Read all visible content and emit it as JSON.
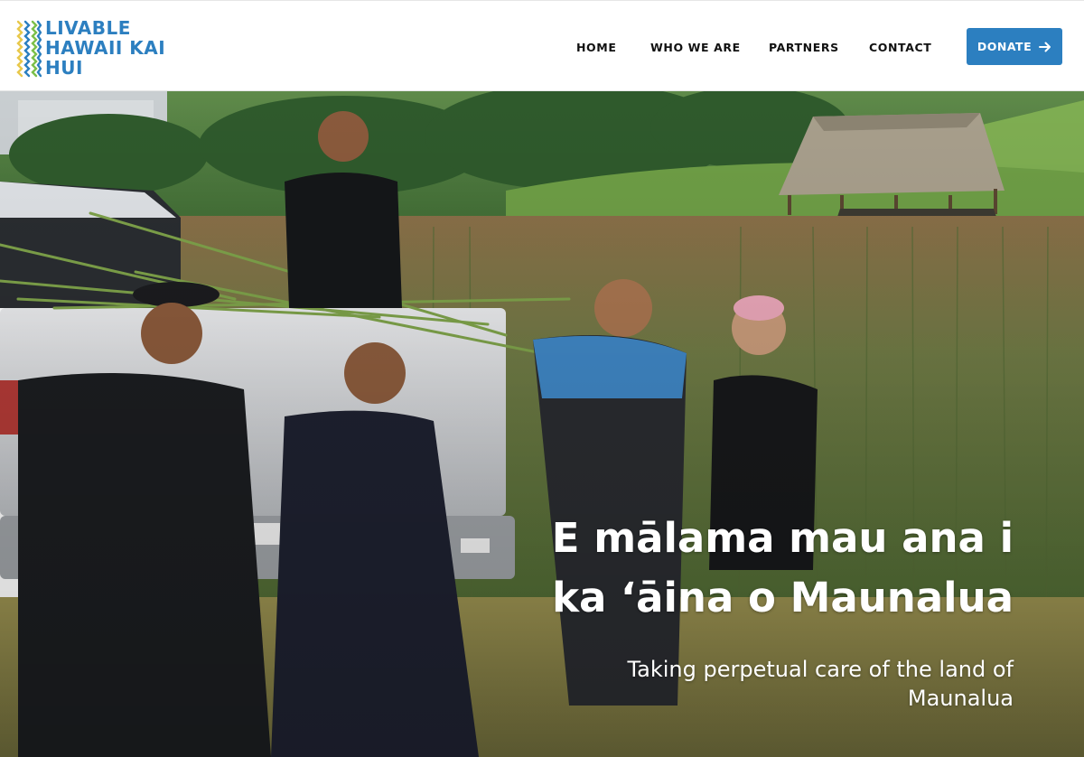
{
  "logo": {
    "lines": [
      "LIVABLE",
      "HAWAII KAI",
      "HUI"
    ],
    "icon": "kapa-pattern-icon"
  },
  "nav": {
    "items": [
      {
        "label": "HOME"
      },
      {
        "label": "WHO WE ARE"
      },
      {
        "label": "PARTNERS"
      },
      {
        "label": "CONTACT"
      }
    ]
  },
  "donate": {
    "label": "DONATE",
    "icon": "arrow-right-icon"
  },
  "hero": {
    "title": "E mālama mau ana i ka ʻāina o Maunalua",
    "subtitle": "Taking perpetual care of the land of Maunalua",
    "photo_icon": "volunteers-photo"
  },
  "colors": {
    "brand_blue": "#2c7fc0",
    "header_bg": "#ffffff",
    "logo_accent_yellow": "#e8c84a",
    "logo_accent_green": "#7bbf4a"
  }
}
